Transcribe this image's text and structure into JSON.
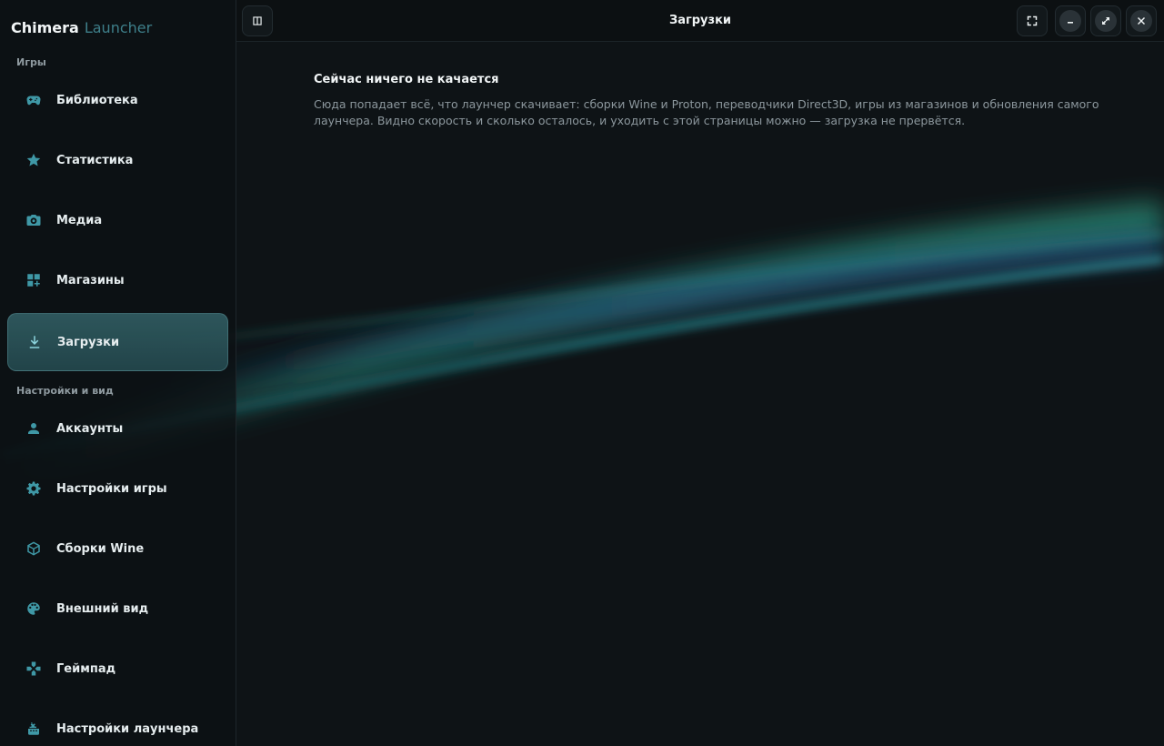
{
  "app": {
    "name": "Chimera",
    "name_suffix": "Launcher"
  },
  "sidebar": {
    "sections": [
      {
        "label": "Игры"
      },
      {
        "label": "Настройки и вид"
      }
    ],
    "items": [
      {
        "label": "Библиотека",
        "icon": "gamepad-icon"
      },
      {
        "label": "Статистика",
        "icon": "star-icon"
      },
      {
        "label": "Медиа",
        "icon": "camera-icon"
      },
      {
        "label": "Магазины",
        "icon": "store-grid-icon"
      },
      {
        "label": "Загрузки",
        "icon": "download-icon",
        "active": true
      },
      {
        "label": "Аккаунты",
        "icon": "person-icon"
      },
      {
        "label": "Настройки игры",
        "icon": "gear-icon"
      },
      {
        "label": "Сборки Wine",
        "icon": "box-icon"
      },
      {
        "label": "Внешний вид",
        "icon": "palette-icon"
      },
      {
        "label": "Геймпад",
        "icon": "dpad-icon"
      },
      {
        "label": "Настройки лаунчера",
        "icon": "launcher-settings-icon"
      }
    ]
  },
  "header": {
    "title": "Загрузки"
  },
  "main": {
    "empty_title": "Сейчас ничего не качается",
    "empty_description": "Сюда попадает всё, что лаунчер скачивает: сборки Wine и Proton, переводчики Direct3D, игры из магазинов и обновления самого лаунчера. Видно скорость и сколько осталось, и уходить с этой страницы можно — загрузка не прервётся."
  },
  "colors": {
    "accent": "#3f98a6",
    "active_item_bg": "#386a70",
    "background": "#0e1316"
  }
}
